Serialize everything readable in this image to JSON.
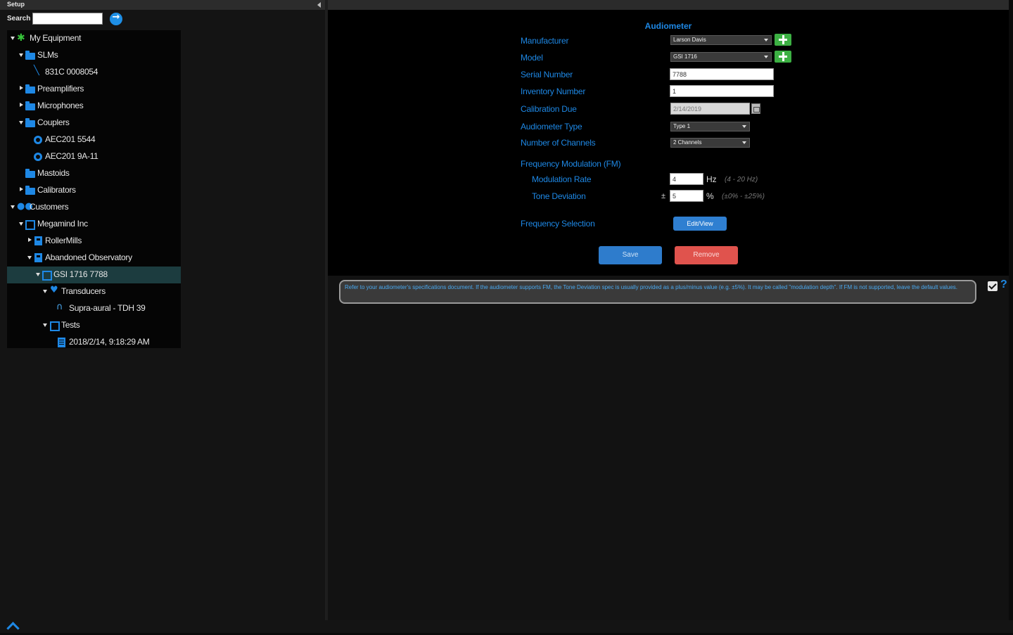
{
  "setup": {
    "title": "Setup"
  },
  "search": {
    "label": "Search",
    "value": ""
  },
  "tree": {
    "items": [
      {
        "label": "My Equipment"
      },
      {
        "label": "SLMs"
      },
      {
        "label": "831C 0008054"
      },
      {
        "label": "Preamplifiers"
      },
      {
        "label": "Microphones"
      },
      {
        "label": "Couplers"
      },
      {
        "label": "AEC201 5544"
      },
      {
        "label": "AEC201 9A-11"
      },
      {
        "label": "Mastoids"
      },
      {
        "label": "Calibrators"
      },
      {
        "label": "Customers"
      },
      {
        "label": "Megamind Inc"
      },
      {
        "label": "RollerMills"
      },
      {
        "label": "Abandoned Observatory"
      },
      {
        "label": "GSI 1716 7788"
      },
      {
        "label": "Transducers"
      },
      {
        "label": "Supra-aural - TDH 39"
      },
      {
        "label": "Tests"
      },
      {
        "label": "2018/2/14, 9:18:29 AM"
      }
    ]
  },
  "form": {
    "title": "Audiometer",
    "manufacturer": {
      "label": "Manufacturer",
      "value": "Larson Davis"
    },
    "model": {
      "label": "Model",
      "value": "GSI 1716"
    },
    "serial": {
      "label": "Serial Number",
      "value": "7788"
    },
    "inventory": {
      "label": "Inventory Number",
      "value": "1"
    },
    "calibration": {
      "label": "Calibration Due",
      "value": "2/14/2019"
    },
    "audiometer_type": {
      "label": "Audiometer Type",
      "value": "Type 1"
    },
    "channels": {
      "label": "Number of Channels",
      "value": "2 Channels"
    },
    "fm": {
      "label": "Frequency Modulation (FM)",
      "rate": {
        "label": "Modulation Rate",
        "value": "4",
        "unit": "Hz",
        "hint": "(4 - 20 Hz)"
      },
      "deviation": {
        "label": "Tone Deviation",
        "prefix": "±",
        "value": "5",
        "unit": "%",
        "hint": "(±0% - ±25%)"
      }
    },
    "freq_selection": {
      "label": "Frequency Selection",
      "button": "Edit/View"
    },
    "save_label": "Save",
    "remove_label": "Remove"
  },
  "help": {
    "text": "Refer to your audiometer's specifications document. If the audiometer supports FM, the Tone Deviation spec is usually provided as a plus/minus value (e.g. ±5%). It may be called \"modulation depth\". If FM is not supported, leave the default values.",
    "question_mark": "?"
  },
  "colors": {
    "accent": "#1e88e5",
    "add": "#3cb043",
    "danger": "#e0534d",
    "selected_row": "#1c3c3f"
  },
  "icons": {
    "my_equipment": "gear-icon",
    "folder": "folder-icon",
    "slm": "probe-icon",
    "coupler": "disc-icon",
    "customers": "people-icon",
    "company": "box-icon",
    "site": "building-icon",
    "device": "audiometer-icon",
    "transducers": "transducer-icon",
    "headphones": "headphones-icon",
    "tests": "folder-icon",
    "test": "document-icon"
  }
}
